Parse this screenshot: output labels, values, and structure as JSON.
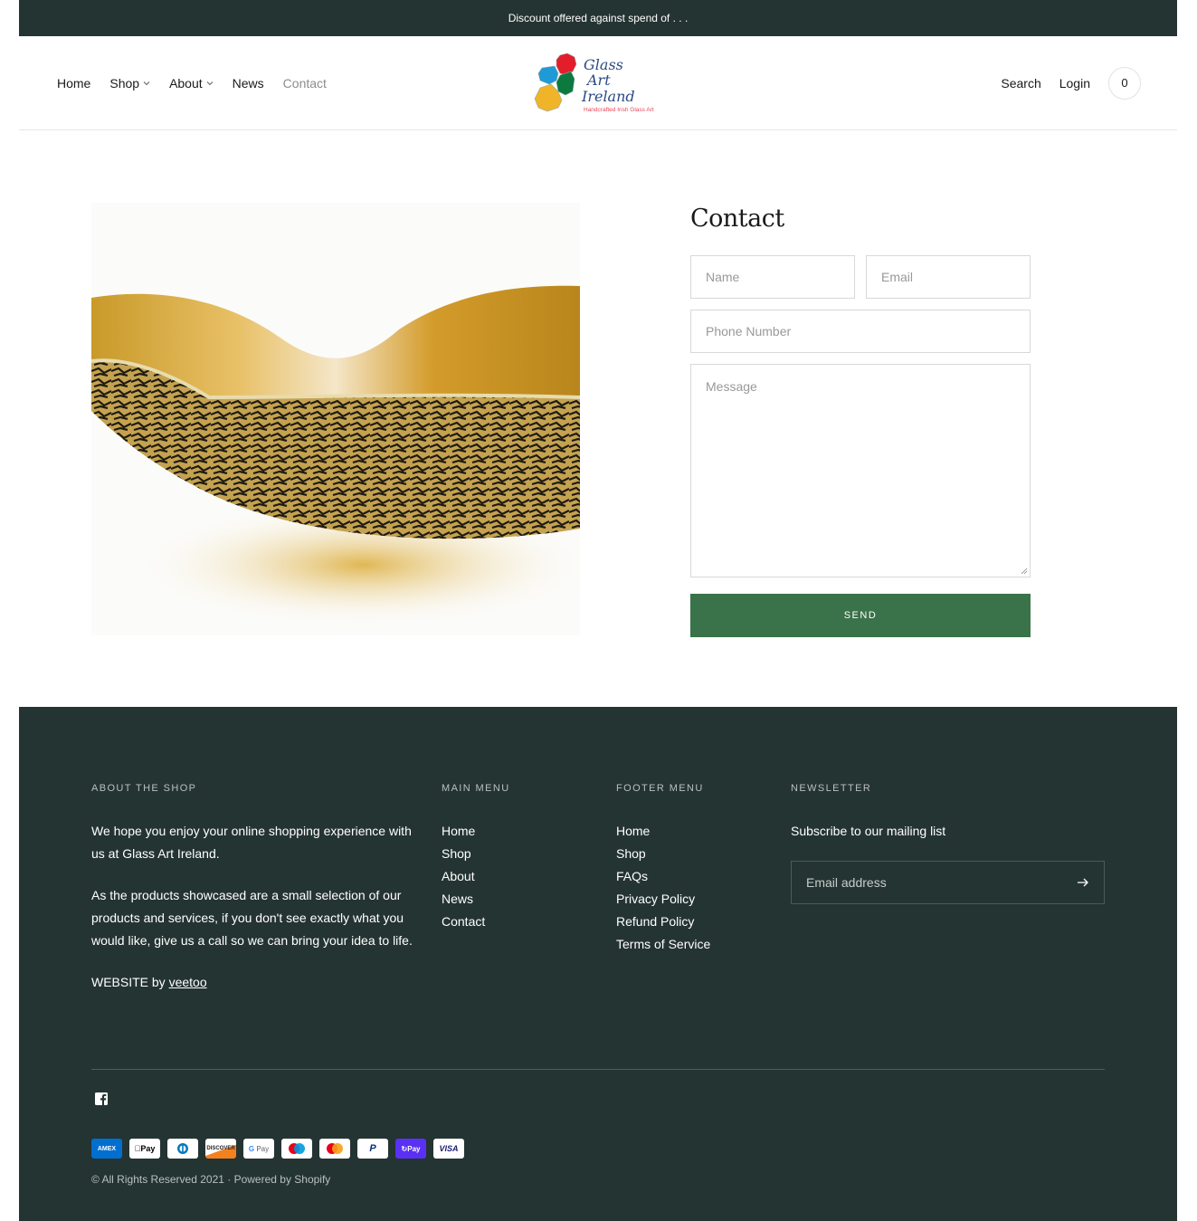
{
  "announcement": "Discount offered against spend of . . .",
  "header": {
    "nav": [
      {
        "label": "Home",
        "dropdown": false,
        "active": false
      },
      {
        "label": "Shop",
        "dropdown": true,
        "active": false
      },
      {
        "label": "About",
        "dropdown": true,
        "active": false
      },
      {
        "label": "News",
        "dropdown": false,
        "active": false
      },
      {
        "label": "Contact",
        "dropdown": false,
        "active": true
      }
    ],
    "logo": {
      "line1": "Glass",
      "line2": "Art",
      "line3": "Ireland",
      "tagline": "Handcrafted Irish Glass Art"
    },
    "search_label": "Search",
    "login_label": "Login",
    "cart_count": "0"
  },
  "contact": {
    "title": "Contact",
    "name_placeholder": "Name",
    "email_placeholder": "Email",
    "phone_placeholder": "Phone Number",
    "message_placeholder": "Message",
    "send_label": "SEND",
    "image_alt": "Gold glass bowl with black crackle pattern"
  },
  "footer": {
    "about": {
      "heading": "ABOUT THE SHOP",
      "p1": "We hope you enjoy your online shopping experience with us at Glass Art Ireland.",
      "p2": "As the products showcased are a small selection of our products and services, if you don't see exactly what you would like, give us a call so we can bring your idea to life.",
      "credit_prefix": "WEBSITE by ",
      "credit_link": "veetoo"
    },
    "main_menu": {
      "heading": "MAIN MENU",
      "items": [
        "Home",
        "Shop",
        "About",
        "News",
        "Contact"
      ]
    },
    "footer_menu": {
      "heading": "FOOTER MENU",
      "items": [
        "Home",
        "Shop",
        "FAQs",
        "Privacy Policy",
        "Refund Policy",
        "Terms of Service"
      ]
    },
    "newsletter": {
      "heading": "NEWSLETTER",
      "text": "Subscribe to our mailing list",
      "placeholder": "Email address"
    },
    "social": [
      "facebook-icon"
    ],
    "payments": [
      "American Express",
      "Apple Pay",
      "Diners Club",
      "Discover",
      "Google Pay",
      "Maestro",
      "Mastercard",
      "PayPal",
      "Shop Pay",
      "Visa"
    ],
    "copyright": "© All Rights Reserved 2021 · Powered by Shopify"
  },
  "colors": {
    "dark_green": "#243432",
    "button_green": "#3a7249",
    "shop_pay_purple": "#5a31f4",
    "amex_blue": "#016fd0"
  }
}
